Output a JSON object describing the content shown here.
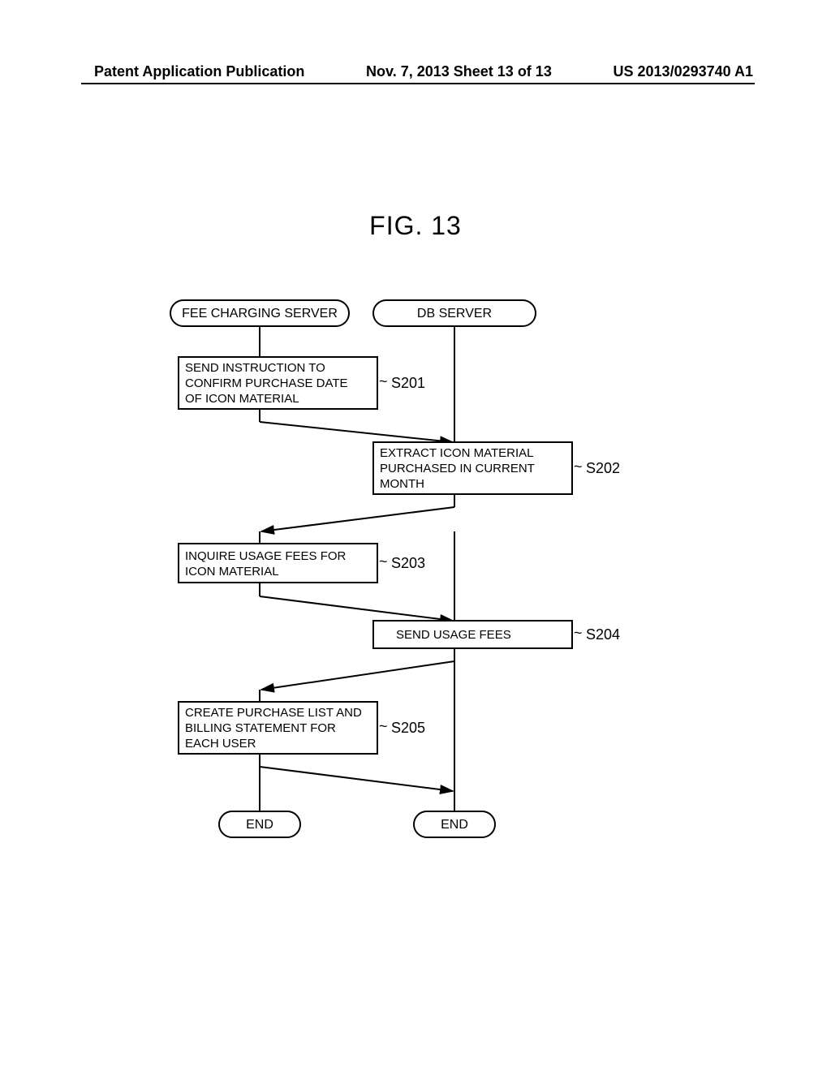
{
  "header": {
    "left": "Patent Application Publication",
    "center": "Nov. 7, 2013  Sheet 13 of 13",
    "right": "US 2013/0293740 A1"
  },
  "figure": {
    "title": "FIG. 13",
    "terminals": {
      "fee_server": "FEE CHARGING SERVER",
      "db_server": "DB SERVER",
      "end_left": "END",
      "end_right": "END"
    },
    "steps": {
      "s201": {
        "label": "S201",
        "line1": "SEND INSTRUCTION TO",
        "line2": "CONFIRM PURCHASE DATE",
        "line3": "OF ICON MATERIAL"
      },
      "s202": {
        "label": "S202",
        "line1": "EXTRACT ICON MATERIAL",
        "line2": "PURCHASED IN CURRENT",
        "line3": "MONTH"
      },
      "s203": {
        "label": "S203",
        "line1": "INQUIRE USAGE FEES FOR",
        "line2": "ICON MATERIAL"
      },
      "s204": {
        "label": "S204",
        "line1": "SEND USAGE FEES"
      },
      "s205": {
        "label": "S205",
        "line1": "CREATE PURCHASE LIST AND",
        "line2": "BILLING STATEMENT FOR",
        "line3": "EACH USER"
      }
    }
  }
}
